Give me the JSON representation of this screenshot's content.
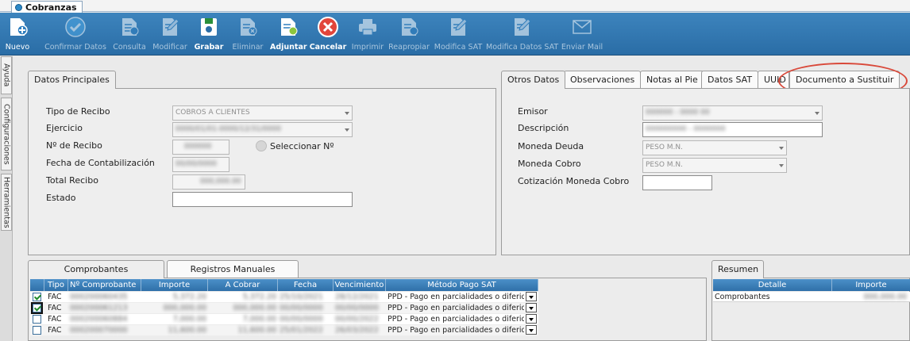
{
  "window_tab": {
    "title": "Cobranzas"
  },
  "toolbar": {
    "buttons": [
      {
        "label": "Nuevo",
        "icon": "new-doc-icon"
      },
      {
        "label": "Confirmar Datos",
        "icon": "check-circle-icon"
      },
      {
        "label": "Consulta",
        "icon": "doc-query-icon"
      },
      {
        "label": "Modificar",
        "icon": "doc-edit-icon"
      },
      {
        "label": "Grabar",
        "icon": "save-icon"
      },
      {
        "label": "Eliminar",
        "icon": "doc-delete-icon"
      },
      {
        "label": "Adjuntar",
        "icon": "attach-icon"
      },
      {
        "label": "Cancelar",
        "icon": "cancel-icon"
      },
      {
        "label": "Imprimir",
        "icon": "printer-icon"
      },
      {
        "label": "Reapropiar",
        "icon": "doc-reassign-icon"
      },
      {
        "label": "Modifica SAT",
        "icon": "doc-edit-sat-icon"
      },
      {
        "label": "Modifica Datos SAT",
        "icon": "doc-edit-sat-data-icon"
      },
      {
        "label": "Enviar Mail",
        "icon": "mail-icon"
      }
    ]
  },
  "side_tabs": [
    "Ayuda",
    "Configuraciones",
    "Herramientas"
  ],
  "principales": {
    "tab": "Datos Principales",
    "fields": {
      "tipo_recibo": {
        "label": "Tipo de Recibo",
        "value": "COBROS A CLIENTES"
      },
      "ejercicio": {
        "label": "Ejercicio",
        "value": "0000/01/01-0000/12/31/0000"
      },
      "num_recibo": {
        "label": "Nº de Recibo",
        "value": "000000"
      },
      "seleccionar": "Seleccionar Nº",
      "fecha": {
        "label": "Fecha de Contabilización",
        "value": "00/00/0000"
      },
      "total": {
        "label": "Total Recibo",
        "value": "000,000.00"
      },
      "estado": {
        "label": "Estado",
        "value": ""
      }
    }
  },
  "otros": {
    "tabs": [
      "Otros Datos",
      "Observaciones",
      "Notas al Pie",
      "Datos SAT",
      "UUID",
      "Documento a Sustituir"
    ],
    "fields": {
      "emisor": {
        "label": "Emisor",
        "value": "000000 - 0000 00"
      },
      "descripcion": {
        "label": "Descripción",
        "value": "000000000 - 0000000"
      },
      "moneda_deuda": {
        "label": "Moneda Deuda",
        "value": "PESO M.N."
      },
      "moneda_cobro": {
        "label": "Moneda Cobro",
        "value": "PESO M.N."
      },
      "cotizacion": {
        "label": "Cotización Moneda Cobro",
        "value": ""
      }
    }
  },
  "comprobantes": {
    "tabs": [
      "Comprobantes",
      "Registros Manuales"
    ],
    "columns": [
      "Tipo",
      "Nº Comprobante",
      "Importe",
      "A Cobrar",
      "Fecha",
      "Vencimiento",
      "Método Pago SAT"
    ],
    "rows": [
      {
        "checked": true,
        "tipo": "FAC",
        "numero": "000200060435",
        "importe": "5,372.20",
        "a_cobrar": "5,372.20",
        "fecha": "25/10/2021",
        "vencimiento": "28/12/2021",
        "metodo": "PPD - Pago en parcialidades o diferido"
      },
      {
        "checked": true,
        "tipo": "FAC",
        "numero": "000200061213",
        "importe": "000,000.00",
        "a_cobrar": "000,000.00",
        "fecha": "00/00/0000",
        "vencimiento": "00/00/0000",
        "metodo": "PPD - Pago en parcialidades o diferido"
      },
      {
        "checked": false,
        "tipo": "FAC",
        "numero": "000200060884",
        "importe": "7,000.00",
        "a_cobrar": "7,000.00",
        "fecha": "00/00/0000",
        "vencimiento": "00/00/2022",
        "metodo": "PPD - Pago en parcialidades o diferido"
      },
      {
        "checked": false,
        "tipo": "FAC",
        "numero": "000200070000",
        "importe": "11,600.00",
        "a_cobrar": "11,600.00",
        "fecha": "25/01/2022",
        "vencimiento": "26/03/2022",
        "metodo": "PPD - Pago en parcialidades o diferido"
      }
    ]
  },
  "resumen": {
    "tab": "Resumen",
    "columns": [
      "Detalle",
      "Importe"
    ],
    "rows": [
      {
        "detalle": "Comprobantes",
        "importe": "000,000.00"
      }
    ]
  },
  "colors": {
    "toolbar": "#2f74ad",
    "accent": "#d9493a",
    "grid_header": "#3a7cb6"
  }
}
